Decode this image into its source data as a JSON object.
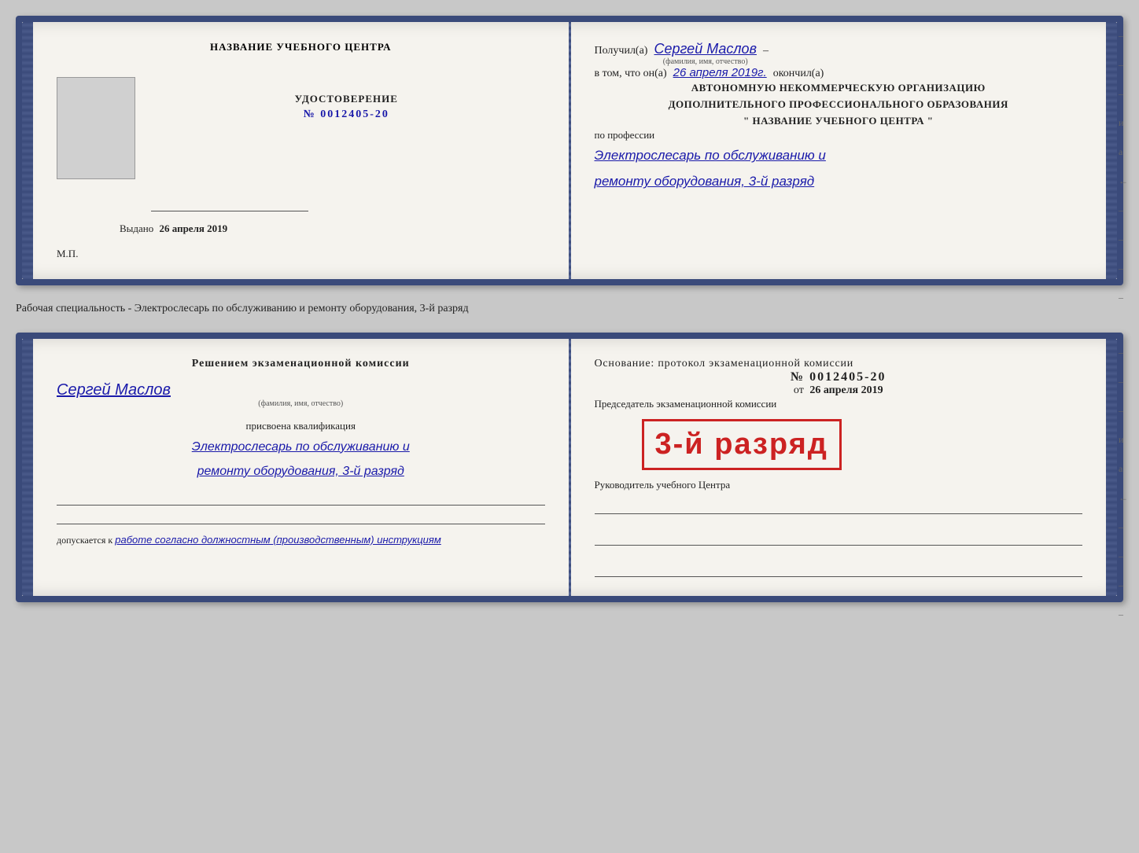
{
  "doc1": {
    "left": {
      "title": "НАЗВАНИЕ УЧЕБНОГО ЦЕНТРА",
      "cert_label": "УДОСТОВЕРЕНИЕ",
      "cert_number_prefix": "№",
      "cert_number": "0012405-20",
      "issued_prefix": "Выдано",
      "issued_date": "26 апреля 2019",
      "mp_label": "М.П."
    },
    "right": {
      "received_prefix": "Получил(а)",
      "recipient_name": "Сергей Маслов",
      "fio_label": "(фамилия, имя, отчество)",
      "dash": "–",
      "date_prefix": "в том, что он(а)",
      "date_value": "26 апреля 2019г.",
      "completed_suffix": "окончил(а)",
      "org_line1": "АВТОНОМНУЮ НЕКОММЕРЧЕСКУЮ ОРГАНИЗАЦИЮ",
      "org_line2": "ДОПОЛНИТЕЛЬНОГО ПРОФЕССИОНАЛЬНОГО ОБРАЗОВАНИЯ",
      "org_line3": "\"  НАЗВАНИЕ УЧЕБНОГО ЦЕНТРА  \"",
      "profession_prefix": "по профессии",
      "profession_value": "Электрослесарь по обслуживанию и",
      "profession_value2": "ремонту оборудования, 3-й разряд"
    }
  },
  "between_label": "Рабочая специальность - Электрослесарь по обслуживанию и ремонту оборудования, 3-й разряд",
  "doc2": {
    "left": {
      "commission_title": "Решением  экзаменационной  комиссии",
      "person_name": "Сергей Маслов",
      "fio_label": "(фамилия, имя, отчество)",
      "qual_prefix": "присвоена квалификация",
      "qual_value": "Электрослесарь по обслуживанию и",
      "qual_value2": "ремонту оборудования, 3-й разряд",
      "допускается_prefix": "допускается к",
      "допускается_value": "работе согласно должностным (производственным) инструкциям"
    },
    "right": {
      "osnование": "Основание: протокол экзаменационной  комиссии",
      "number_prefix": "№",
      "number_value": "0012405-20",
      "date_prefix": "от",
      "date_value": "26 апреля 2019",
      "chairman_label": "Председатель экзаменационной комиссии",
      "stamp_text": "3-й разряд",
      "руководитель_label": "Руководитель учебного Центра"
    }
  }
}
